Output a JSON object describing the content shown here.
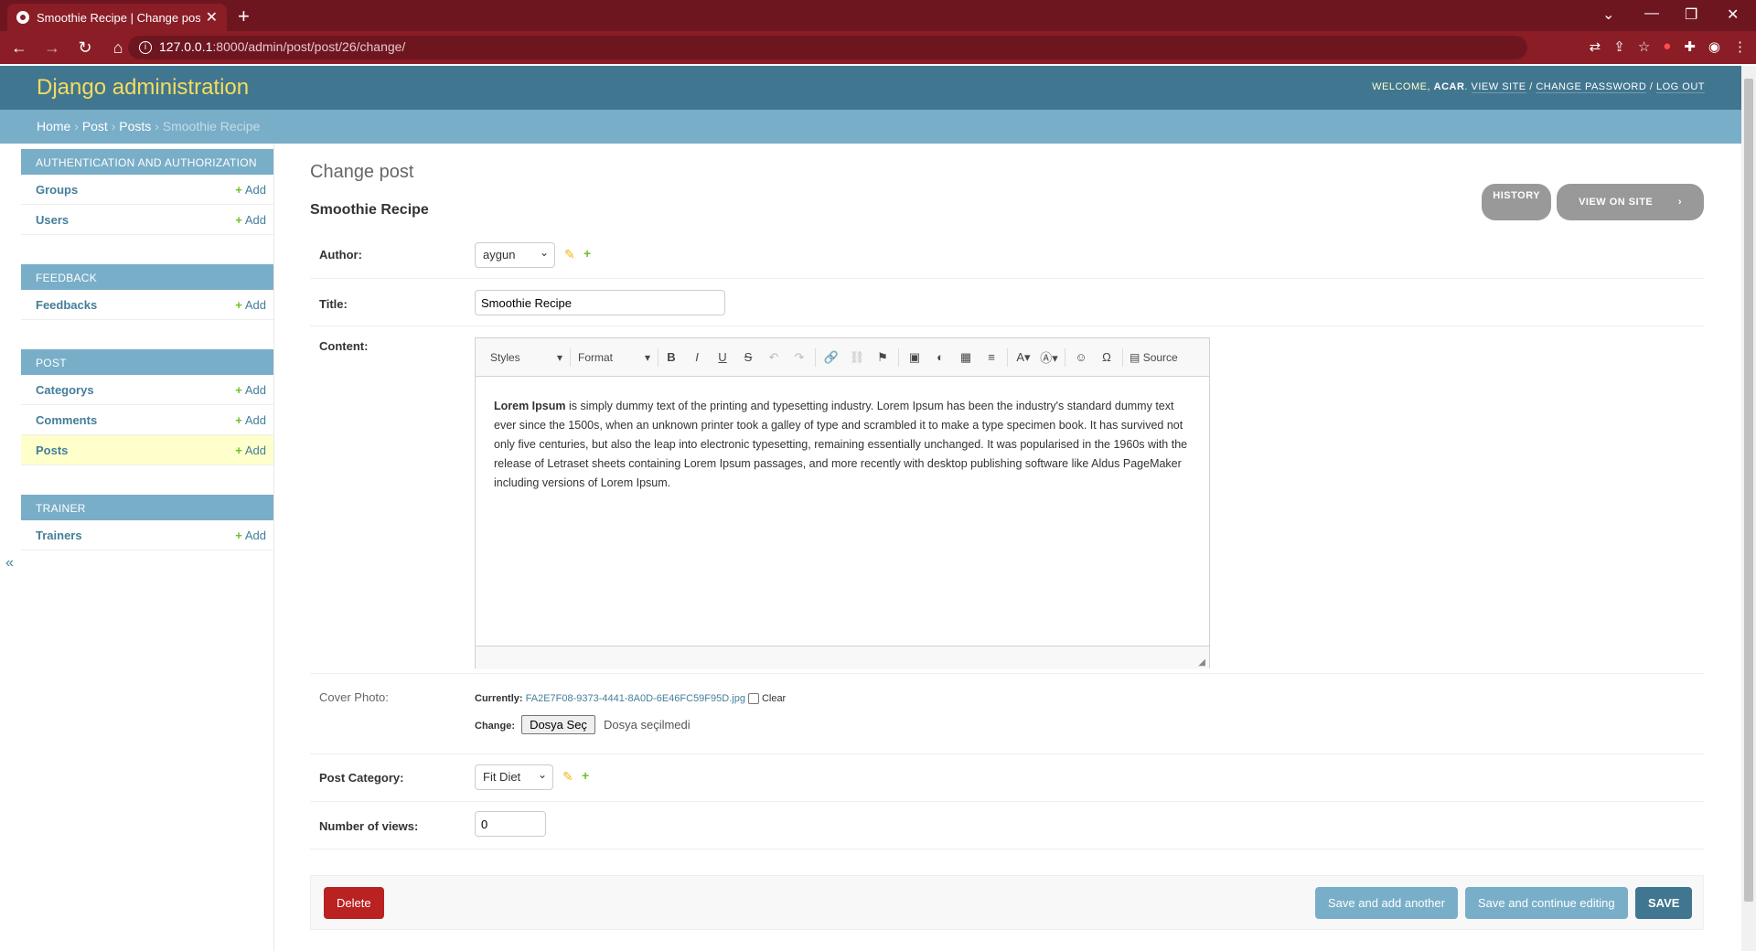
{
  "browser": {
    "tab_title": "Smoothie Recipe | Change post |",
    "url_host": "127.0.0.1",
    "url_path": ":8000/admin/post/post/26/change/"
  },
  "header": {
    "brand": "Django administration",
    "welcome": "Welcome,",
    "username": "ACAR",
    "view_site": "View site",
    "change_password": "Change password",
    "log_out": "Log out"
  },
  "breadcrumbs": {
    "home": "Home",
    "app": "Post",
    "model": "Posts",
    "current": "Smoothie Recipe",
    "sep": "›"
  },
  "sidebar": {
    "add_label": "Add",
    "collapse": "«",
    "modules": [
      {
        "caption": "Authentication and Authorization",
        "items": [
          "Groups",
          "Users"
        ]
      },
      {
        "caption": "Feedback",
        "items": [
          "Feedbacks"
        ]
      },
      {
        "caption": "Post",
        "items": [
          "Categorys",
          "Comments",
          "Posts"
        ]
      },
      {
        "caption": "Trainer",
        "items": [
          "Trainers"
        ]
      }
    ]
  },
  "main": {
    "title": "Change post",
    "object_name": "Smoothie Recipe",
    "history": "History",
    "view_on_site": "View on site",
    "fields": {
      "author_label": "Author:",
      "author_value": "aygun",
      "title_label": "Title:",
      "title_value": "Smoothie Recipe",
      "content_label": "Content:",
      "cover_label": "Cover Photo:",
      "currently_label": "Currently:",
      "cover_file": "FA2E7F08-9373-4441-8A0D-6E46FC59F95D.jpg",
      "clear_label": "Clear",
      "change_label": "Change:",
      "file_button": "Dosya Seç",
      "no_file": "Dosya seçilmedi",
      "category_label": "Post Category:",
      "category_value": "Fit Diet",
      "views_label": "Number of views:",
      "views_value": "0"
    },
    "editor": {
      "styles": "Styles",
      "format": "Format",
      "source": "Source",
      "content_bold": "Lorem Ipsum",
      "content_rest": " is simply dummy text of the printing and typesetting industry. Lorem Ipsum has been the industry's standard dummy text ever since the 1500s, when an unknown printer took a galley of type and scrambled it to make a type specimen book. It has survived not only five centuries, but also the leap into electronic typesetting, remaining essentially unchanged. It was popularised in the 1960s with the release of Letraset sheets containing Lorem Ipsum passages, and more recently with desktop publishing software like Aldus PageMaker including versions of Lorem Ipsum."
    },
    "buttons": {
      "delete": "Delete",
      "save_add": "Save and add another",
      "save_continue": "Save and continue editing",
      "save": "SAVE"
    }
  },
  "colors": {
    "header": "#417690",
    "breadcrumbs": "#79aec8",
    "brand": "#f5dd5d",
    "delete": "#ba2121",
    "browser_frame": "#8a1d26"
  }
}
